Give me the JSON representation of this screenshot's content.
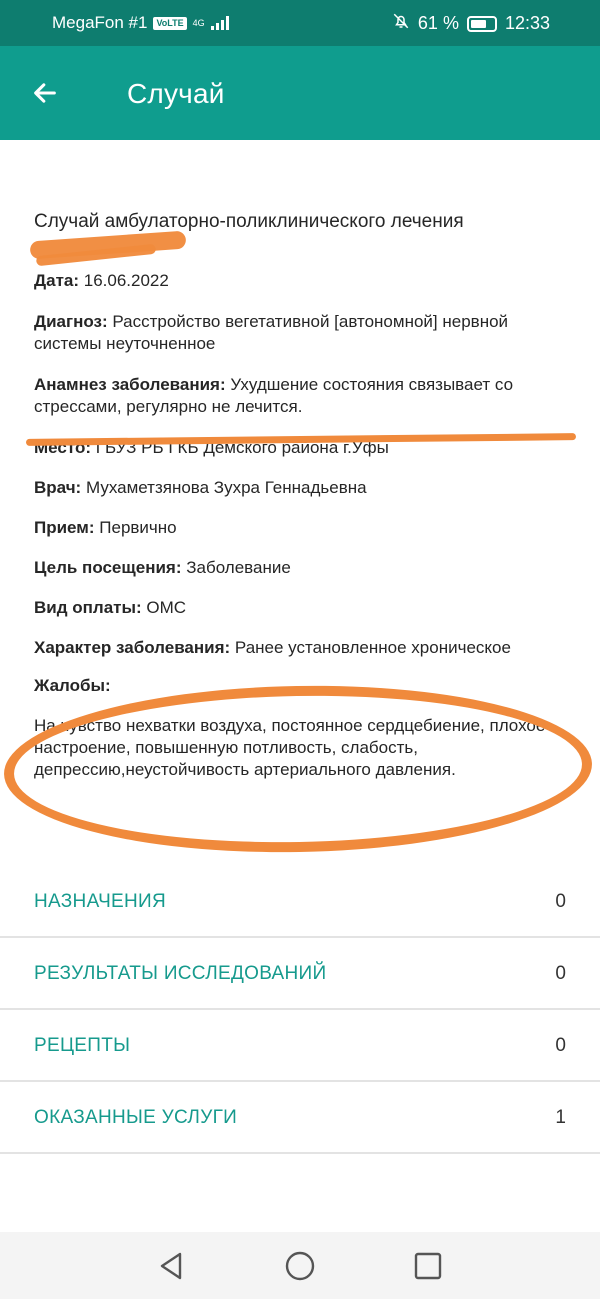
{
  "status_bar": {
    "carrier": "MegaFon #1",
    "volte": "VoLTE",
    "network": "4G",
    "battery": "61 %",
    "time": "12:33"
  },
  "app_bar": {
    "title": "Случай",
    "back_icon": "arrow-left-icon"
  },
  "case": {
    "title": "Случай амбулаторно-поликлинического лечения",
    "fields": [
      {
        "label": "Дата:",
        "value": "16.06.2022"
      },
      {
        "label": "Диагноз:",
        "value": "Расстройство вегетативной [автономной] нервной системы неуточненное"
      },
      {
        "label": "Анамнез заболевания:",
        "value": "Ухудшение  состояния  связывает со стрессами, регулярно не  лечится."
      },
      {
        "label": "Место:",
        "value": "ГБУЗ РБ ГКБ Демского района г.Уфы"
      },
      {
        "label": "Врач:",
        "value": "Мухаметзянова Зухра Геннадьевна"
      },
      {
        "label": "Прием:",
        "value": "Первично"
      },
      {
        "label": "Цель посещения:",
        "value": "Заболевание"
      },
      {
        "label": "Вид оплаты:",
        "value": "ОМС"
      },
      {
        "label": "Характер заболевания:",
        "value": "Ранее установленное хроническое"
      }
    ],
    "complaints_label": "Жалобы:",
    "complaints_text": "На чувство нехватки  воздуха, постоянное сердцебиение, плохое настроение, повышенную потливость, слабость, депрессию,неустойчивость артериального  давления."
  },
  "sections": [
    {
      "label": "НАЗНАЧЕНИЯ",
      "count": "0"
    },
    {
      "label": "РЕЗУЛЬТАТЫ ИССЛЕДОВАНИЙ",
      "count": "0"
    },
    {
      "label": "РЕЦЕПТЫ",
      "count": "0"
    },
    {
      "label": "ОКАЗАННЫЕ УСЛУГИ",
      "count": "1"
    }
  ],
  "nav_bar": {
    "back": "triangle-back-icon",
    "home": "circle-home-icon",
    "recents": "square-recents-icon"
  },
  "colors": {
    "status_bar": "#0e7d6f",
    "app_bar": "#0f9d8e",
    "accent_text": "#169a8d",
    "annotation": "#f08a3c"
  }
}
